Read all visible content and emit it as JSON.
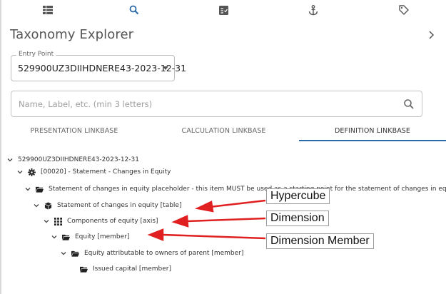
{
  "toolbar": {
    "icons": [
      "list-icon",
      "search-icon",
      "fact-table-icon",
      "anchor-icon",
      "tag-icon"
    ],
    "accent_color": "#2a6aa8"
  },
  "panel": {
    "title": "Taxonomy Explorer"
  },
  "entry_point": {
    "legend": "Entry Point",
    "value": "529900UZ3DIIHDNERE43-2023-12-31"
  },
  "search": {
    "placeholder": "Name, Label, etc. (min 3 letters)",
    "value": ""
  },
  "tabs": [
    {
      "label": "PRESENTATION LINKBASE",
      "active": false
    },
    {
      "label": "CALCULATION LINKBASE",
      "active": false
    },
    {
      "label": "DEFINITION LINKBASE",
      "active": true
    }
  ],
  "tree": [
    {
      "label": "529900UZ3DIIHDNERE43-2023-12-31",
      "icon": "none",
      "expanded": true
    },
    {
      "label": "[00020] - Statement - Changes in Equity",
      "icon": "gear-icon",
      "expanded": true
    },
    {
      "label": "Statement of changes in equity placeholder - this item MUST be used as a starting point for the statement of changes in equity",
      "icon": "folder-icon",
      "expanded": true
    },
    {
      "label": "Statement of changes in equity [table]",
      "icon": "cube-icon",
      "expanded": true
    },
    {
      "label": "Components of equity [axis]",
      "icon": "grid-icon",
      "expanded": true
    },
    {
      "label": "Equity [member]",
      "icon": "folder-icon",
      "expanded": true
    },
    {
      "label": "Equity attributable to owners of parent [member]",
      "icon": "folder-icon",
      "expanded": true
    },
    {
      "label": "Issued capital [member]",
      "icon": "folder-icon",
      "expanded": false
    }
  ],
  "annotations": {
    "color": "#e02020",
    "items": [
      {
        "text": "Hypercube"
      },
      {
        "text": "Dimension"
      },
      {
        "text": "Dimension Member"
      }
    ]
  }
}
